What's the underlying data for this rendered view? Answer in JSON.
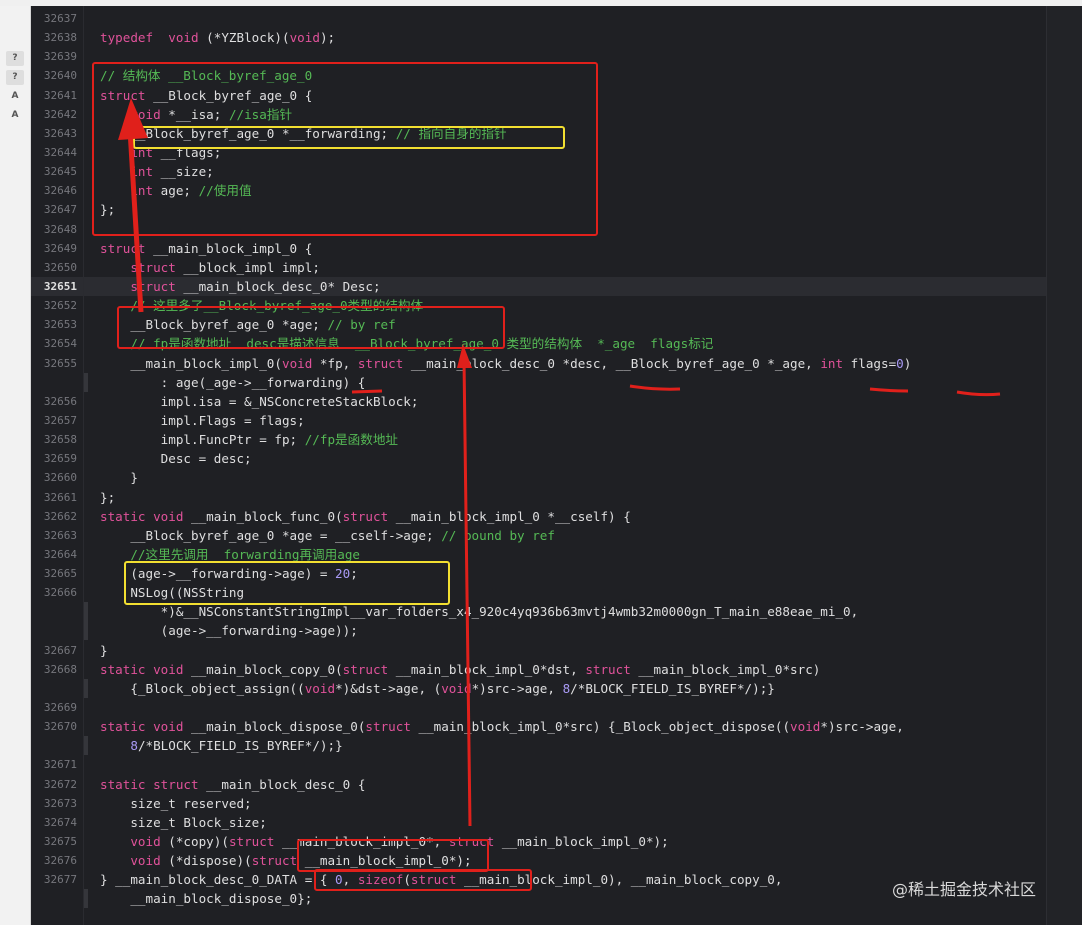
{
  "issue_markers": [
    "?",
    "?",
    "A",
    "A"
  ],
  "current_line": "32651",
  "watermark": "@稀土掘金技术社区",
  "colors": {
    "background": "#1f2024",
    "keyword": "#e0529a",
    "comment": "#55b955",
    "number": "#a99af5",
    "text": "#dfdfe0",
    "annotation_red": "#e0201b",
    "annotation_yellow": "#f2df31"
  },
  "lines": [
    {
      "n": "32637",
      "t": []
    },
    {
      "n": "32638",
      "t": [
        [
          "kw",
          "typedef"
        ],
        [
          "",
          "  "
        ],
        [
          "kw",
          "void"
        ],
        [
          "",
          " (*YZBlock)("
        ],
        [
          "kw",
          "void"
        ],
        [
          "",
          ");"
        ]
      ]
    },
    {
      "n": "32639",
      "t": []
    },
    {
      "n": "32640",
      "t": [
        [
          "cm",
          "// 结构体 __Block_byref_age_0"
        ]
      ]
    },
    {
      "n": "32641",
      "t": [
        [
          "kw",
          "struct"
        ],
        [
          "",
          " __Block_byref_age_0 {"
        ]
      ]
    },
    {
      "n": "32642",
      "t": [
        [
          "",
          "    "
        ],
        [
          "kw",
          "void"
        ],
        [
          "",
          " *__isa; "
        ],
        [
          "cm",
          "//isa指针"
        ]
      ]
    },
    {
      "n": "32643",
      "t": [
        [
          "",
          "    __Block_byref_age_0 *__forwarding; "
        ],
        [
          "cm",
          "// 指向自身的指针"
        ]
      ]
    },
    {
      "n": "32644",
      "t": [
        [
          "",
          "    "
        ],
        [
          "kw",
          "int"
        ],
        [
          "",
          " __flags;"
        ]
      ]
    },
    {
      "n": "32645",
      "t": [
        [
          "",
          "    "
        ],
        [
          "kw",
          "int"
        ],
        [
          "",
          " __size;"
        ]
      ]
    },
    {
      "n": "32646",
      "t": [
        [
          "",
          "    "
        ],
        [
          "kw",
          "int"
        ],
        [
          "",
          " age; "
        ],
        [
          "cm",
          "//使用值"
        ]
      ]
    },
    {
      "n": "32647",
      "t": [
        [
          "",
          "};"
        ]
      ]
    },
    {
      "n": "32648",
      "t": []
    },
    {
      "n": "32649",
      "t": [
        [
          "kw",
          "struct"
        ],
        [
          "",
          " __main_block_impl_0 {"
        ]
      ]
    },
    {
      "n": "32650",
      "t": [
        [
          "",
          "    "
        ],
        [
          "kw",
          "struct"
        ],
        [
          "",
          " __block_impl impl;"
        ]
      ]
    },
    {
      "n": "32651",
      "t": [
        [
          "",
          "    "
        ],
        [
          "kw",
          "struct"
        ],
        [
          "",
          " __main_block_desc_0* Desc;"
        ]
      ]
    },
    {
      "n": "32652",
      "t": [
        [
          "",
          "    "
        ],
        [
          "cm",
          "// 这里多了__Block_byref_age_0类型的结构体"
        ]
      ]
    },
    {
      "n": "32653",
      "t": [
        [
          "",
          "    __Block_byref_age_0 *age; "
        ],
        [
          "cm",
          "// by ref"
        ]
      ]
    },
    {
      "n": "32654",
      "t": [
        [
          "",
          "    "
        ],
        [
          "cm",
          "// fp是函数地址  desc是描述信息  __Block_byref_age_0 类型的结构体  *_age  flags标记"
        ]
      ]
    },
    {
      "n": "32655",
      "t": [
        [
          "",
          "    __main_block_impl_0("
        ],
        [
          "kw",
          "void"
        ],
        [
          "",
          " *fp, "
        ],
        [
          "kw",
          "struct"
        ],
        [
          "",
          " __main_block_desc_0 *desc, __Block_byref_age_0 *_age, "
        ],
        [
          "kw",
          "int"
        ],
        [
          "",
          " flags="
        ],
        [
          "num",
          "0"
        ],
        [
          "",
          ")"
        ]
      ]
    },
    {
      "n": "",
      "t": [
        [
          "",
          "        : age(_age->__forwarding) {"
        ]
      ]
    },
    {
      "n": "32656",
      "t": [
        [
          "",
          "        impl.isa = &_NSConcreteStackBlock;"
        ]
      ]
    },
    {
      "n": "32657",
      "t": [
        [
          "",
          "        impl.Flags = flags;"
        ]
      ]
    },
    {
      "n": "32658",
      "t": [
        [
          "",
          "        impl.FuncPtr = fp; "
        ],
        [
          "cm",
          "//fp是函数地址"
        ]
      ]
    },
    {
      "n": "32659",
      "t": [
        [
          "",
          "        Desc = desc;"
        ]
      ]
    },
    {
      "n": "32660",
      "t": [
        [
          "",
          "    }"
        ]
      ]
    },
    {
      "n": "32661",
      "t": [
        [
          "",
          "};"
        ]
      ]
    },
    {
      "n": "32662",
      "t": [
        [
          "kw",
          "static"
        ],
        [
          "",
          " "
        ],
        [
          "kw",
          "void"
        ],
        [
          "",
          " __main_block_func_0("
        ],
        [
          "kw",
          "struct"
        ],
        [
          "",
          " __main_block_impl_0 *__cself) {"
        ]
      ]
    },
    {
      "n": "32663",
      "t": [
        [
          "",
          "    __Block_byref_age_0 *age = __cself->age; "
        ],
        [
          "cm",
          "// bound by ref"
        ]
      ]
    },
    {
      "n": "32664",
      "t": [
        [
          "",
          "    "
        ],
        [
          "cm",
          "//这里先调用__forwarding再调用age"
        ]
      ]
    },
    {
      "n": "32665",
      "t": [
        [
          "",
          "    (age->__forwarding->age) = "
        ],
        [
          "num",
          "20"
        ],
        [
          "",
          ";"
        ]
      ]
    },
    {
      "n": "32666",
      "t": [
        [
          "",
          "    NSLog((NSString"
        ]
      ]
    },
    {
      "n": "",
      "t": [
        [
          "",
          "        *)&__NSConstantStringImpl__var_folders_x4_920c4yq936b63mvtj4wmb32m0000gn_T_main_e88eae_mi_0,"
        ]
      ]
    },
    {
      "n": "",
      "t": [
        [
          "",
          "        (age->__forwarding->age));"
        ]
      ]
    },
    {
      "n": "32667",
      "t": [
        [
          "",
          "}"
        ]
      ]
    },
    {
      "n": "32668",
      "t": [
        [
          "kw",
          "static"
        ],
        [
          "",
          " "
        ],
        [
          "kw",
          "void"
        ],
        [
          "",
          " __main_block_copy_0("
        ],
        [
          "kw",
          "struct"
        ],
        [
          "",
          " __main_block_impl_0*dst, "
        ],
        [
          "kw",
          "struct"
        ],
        [
          "",
          " __main_block_impl_0*src)"
        ]
      ]
    },
    {
      "n": "",
      "t": [
        [
          "",
          "    {_Block_object_assign(("
        ],
        [
          "kw",
          "void"
        ],
        [
          "",
          "*)&dst->age, ("
        ],
        [
          "kw",
          "void"
        ],
        [
          "",
          "*)src->age, "
        ],
        [
          "num",
          "8"
        ],
        [
          "",
          "/*BLOCK_FIELD_IS_BYREF*/);}"
        ]
      ]
    },
    {
      "n": "32669",
      "t": []
    },
    {
      "n": "32670",
      "t": [
        [
          "kw",
          "static"
        ],
        [
          "",
          " "
        ],
        [
          "kw",
          "void"
        ],
        [
          "",
          " __main_block_dispose_0("
        ],
        [
          "kw",
          "struct"
        ],
        [
          "",
          " __main_block_impl_0*src) {_Block_object_dispose(("
        ],
        [
          "kw",
          "void"
        ],
        [
          "",
          "*)src->age,"
        ]
      ]
    },
    {
      "n": "",
      "t": [
        [
          "",
          "    "
        ],
        [
          "num",
          "8"
        ],
        [
          "",
          "/*BLOCK_FIELD_IS_BYREF*/);}"
        ]
      ]
    },
    {
      "n": "32671",
      "t": []
    },
    {
      "n": "32672",
      "t": [
        [
          "kw",
          "static"
        ],
        [
          "",
          " "
        ],
        [
          "kw",
          "struct"
        ],
        [
          "",
          " __main_block_desc_0 {"
        ]
      ]
    },
    {
      "n": "32673",
      "t": [
        [
          "",
          "    size_t reserved;"
        ]
      ]
    },
    {
      "n": "32674",
      "t": [
        [
          "",
          "    size_t Block_size;"
        ]
      ]
    },
    {
      "n": "32675",
      "t": [
        [
          "",
          "    "
        ],
        [
          "kw",
          "void"
        ],
        [
          "",
          " (*copy)("
        ],
        [
          "kw",
          "struct"
        ],
        [
          "",
          " __main_block_impl_0*, "
        ],
        [
          "kw",
          "struct"
        ],
        [
          "",
          " __main_block_impl_0*);"
        ]
      ]
    },
    {
      "n": "32676",
      "t": [
        [
          "",
          "    "
        ],
        [
          "kw",
          "void"
        ],
        [
          "",
          " (*dispose)("
        ],
        [
          "kw",
          "struct"
        ],
        [
          "",
          " __main_block_impl_0*);"
        ]
      ]
    },
    {
      "n": "32677",
      "t": [
        [
          "",
          "} __main_block_desc_0_DATA = { "
        ],
        [
          "num",
          "0"
        ],
        [
          "",
          ", "
        ],
        [
          "kw",
          "sizeof"
        ],
        [
          "",
          "("
        ],
        [
          "kw",
          "struct"
        ],
        [
          "",
          " __main_block_impl_0), __main_block_copy_0,"
        ]
      ]
    },
    {
      "n": "",
      "t": [
        [
          "",
          "    __main_block_dispose_0};"
        ]
      ]
    }
  ]
}
